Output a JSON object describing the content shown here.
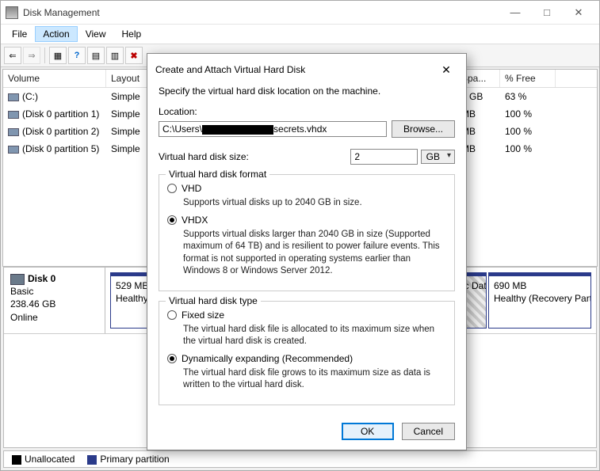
{
  "window": {
    "title": "Disk Management",
    "menus": [
      "File",
      "Action",
      "View",
      "Help"
    ],
    "active_menu_index": 1
  },
  "columns": [
    "Volume",
    "Layout",
    "Spa...",
    "% Free"
  ],
  "volumes": [
    {
      "name": "(C:)",
      "layout": "Simple",
      "space": "1 GB",
      "free": "63 %"
    },
    {
      "name": "(Disk 0 partition 1)",
      "layout": "Simple",
      "space": "MB",
      "free": "100 %"
    },
    {
      "name": "(Disk 0 partition 2)",
      "layout": "Simple",
      "space": "MB",
      "free": "100 %"
    },
    {
      "name": "(Disk 0 partition 5)",
      "layout": "Simple",
      "space": "MB",
      "free": "100 %"
    }
  ],
  "disk": {
    "label": "Disk 0",
    "type": "Basic",
    "size": "238.46 GB",
    "status": "Online",
    "parts": [
      {
        "line1": "529 MB",
        "line2": "Healthy (Reco"
      },
      {
        "line1": "",
        "line2": "sic Dat",
        "hatch": true
      },
      {
        "line1": "690 MB",
        "line2": "Healthy (Recovery Partit"
      }
    ]
  },
  "legend": {
    "unalloc": "Unallocated",
    "primary": "Primary partition"
  },
  "dialog": {
    "title": "Create and Attach Virtual Hard Disk",
    "desc": "Specify the virtual hard disk location on the machine.",
    "location_label": "Location:",
    "location_prefix": "C:\\Users\\",
    "location_suffix": "secrets.vhdx",
    "browse": "Browse...",
    "size_label": "Virtual hard disk size:",
    "size_value": "2",
    "size_unit": "GB",
    "format": {
      "group": "Virtual hard disk format",
      "vhd": "VHD",
      "vhd_desc": "Supports virtual disks up to 2040 GB in size.",
      "vhdx": "VHDX",
      "vhdx_desc": "Supports virtual disks larger than 2040 GB in size (Supported maximum of 64 TB) and is resilient to power failure events. This format is not supported in operating systems earlier than Windows 8 or Windows Server 2012."
    },
    "type": {
      "group": "Virtual hard disk type",
      "fixed": "Fixed size",
      "fixed_desc": "The virtual hard disk file is allocated to its maximum size when the virtual hard disk is created.",
      "dyn": "Dynamically expanding (Recommended)",
      "dyn_desc": "The virtual hard disk file grows to its maximum size as data is written to the virtual hard disk."
    },
    "ok": "OK",
    "cancel": "Cancel"
  }
}
